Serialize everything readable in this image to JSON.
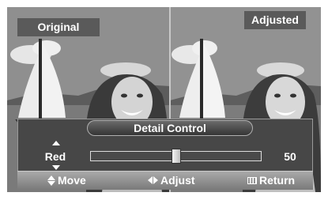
{
  "compare": {
    "left_label": "Original",
    "right_label": "Adjusted"
  },
  "menu": {
    "title": "Detail Control",
    "item_label": "Red",
    "value": "50",
    "slider_fraction": 0.5
  },
  "hints": {
    "move": "Move",
    "adjust": "Adjust",
    "return": "Return"
  },
  "icons": {
    "move": "up-down-arrows-icon",
    "adjust": "left-right-arrows-icon",
    "return": "menu-icon"
  }
}
